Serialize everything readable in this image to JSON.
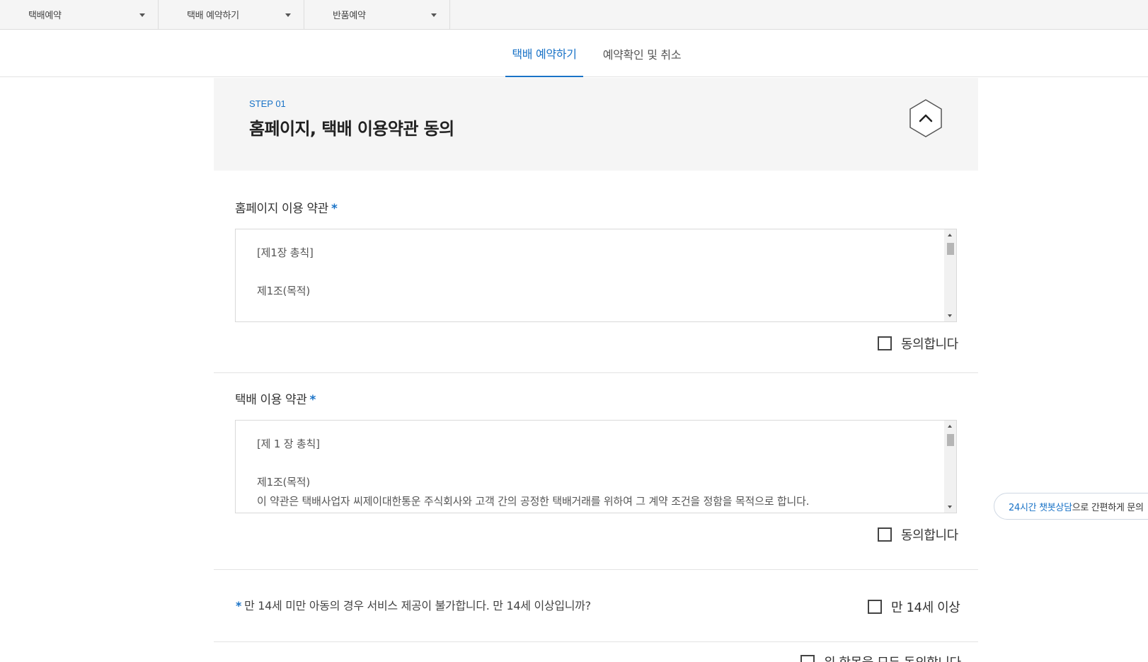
{
  "topbar": {
    "dropdowns": [
      {
        "label": "택배예약"
      },
      {
        "label": "택배 예약하기"
      },
      {
        "label": "반품예약"
      }
    ]
  },
  "tabs": [
    {
      "label": "택배 예약하기",
      "active": true
    },
    {
      "label": "예약확인 및 취소",
      "active": false
    }
  ],
  "step": {
    "number": "STEP 01",
    "title": "홈페이지, 택배 이용약관 동의",
    "collapse_icon": "chevron-up-icon"
  },
  "homepage_terms": {
    "title": "홈페이지 이용 약관",
    "required_mark": "*",
    "lines": [
      "[제1장 총칙]",
      "제1조(목적)"
    ],
    "agree_label": "동의합니다"
  },
  "delivery_terms": {
    "title": "택배 이용 약관",
    "required_mark": "*",
    "lines": [
      "[제 1 장 총칙]",
      "제1조(목적)",
      "이 약관은 택배사업자 씨제이대한통운 주식회사와 고객 간의 공정한 택배거래를 위하여 그 계약 조건을 정함을 목적으로 합니다."
    ],
    "agree_label": "동의합니다"
  },
  "age_check": {
    "required_mark": "*",
    "question": "만 14세 미만 아동의 경우 서비스 제공이 불가합니다. 만 14세 이상입니까?",
    "checkbox_label": "만 14세 이상"
  },
  "agree_all": {
    "label": "위 항목을 모두 동의합니다"
  },
  "chat": {
    "highlight": "24시간 챗봇상담",
    "rest": "으로 간편하게 문의"
  },
  "colors": {
    "accent": "#1a73c7",
    "panel_bg": "#f5f5f5",
    "border": "#d9d9d9"
  }
}
